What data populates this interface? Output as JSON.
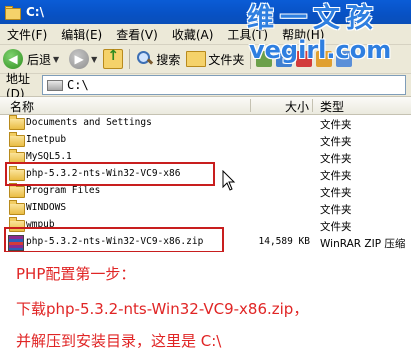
{
  "window": {
    "title": "C:\\"
  },
  "menu": [
    "文件(F)",
    "编辑(E)",
    "查看(V)",
    "收藏(A)",
    "工具(T)",
    "帮助(H)"
  ],
  "toolbar": {
    "back_label": "后退",
    "search_label": "搜索",
    "folders_label": "文件夹"
  },
  "address": {
    "label": "地址(D)",
    "value": "C:\\"
  },
  "columns": {
    "name": "名称",
    "size": "大小",
    "type": "类型"
  },
  "files": [
    {
      "name": "Documents and Settings",
      "size": "",
      "type": "文件夹"
    },
    {
      "name": "Inetpub",
      "size": "",
      "type": "文件夹"
    },
    {
      "name": "MySQL5.1",
      "size": "",
      "type": "文件夹"
    },
    {
      "name": "php-5.3.2-nts-Win32-VC9-x86",
      "size": "",
      "type": "文件夹"
    },
    {
      "name": "Program Files",
      "size": "",
      "type": "文件夹"
    },
    {
      "name": "WINDOWS",
      "size": "",
      "type": "文件夹"
    },
    {
      "name": "wmpub",
      "size": "",
      "type": "文件夹"
    },
    {
      "name": "php-5.3.2-nts-Win32-VC9-x86.zip",
      "size": "14,589 KB",
      "type": "WinRAR ZIP 压缩"
    }
  ],
  "watermark": {
    "line1": "维一文孩",
    "line2": "vegirl.com"
  },
  "annotation": {
    "line1": "PHP配置第一步：",
    "line2": "下载php-5.3.2-nts-Win32-VC9-x86.zip，",
    "line3": "并解压到安装目录，这里是 C:\\"
  },
  "colors": {
    "titlebar": "#0851c4",
    "highlight": "#c81e1e",
    "annotation": "#e02525",
    "watermark": "#2f7fe0"
  }
}
